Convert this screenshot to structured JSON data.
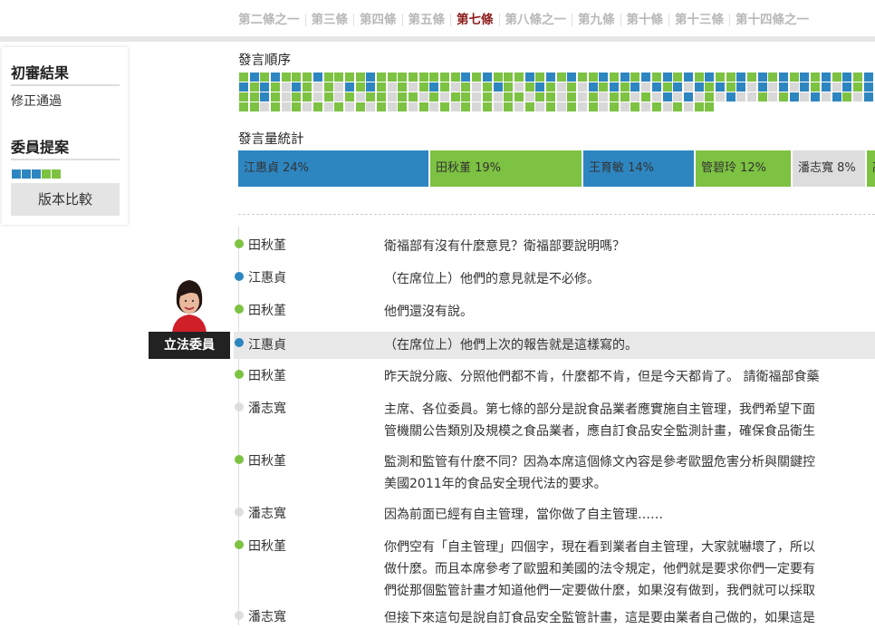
{
  "tabs": [
    "第二條之一",
    "第三條",
    "第四條",
    "第五條",
    "第七條",
    "第八條之一",
    "第九條",
    "第十條",
    "第十三條",
    "第十四條之一"
  ],
  "active_tab": 4,
  "sidebar": {
    "result_heading": "初審結果",
    "result_value": "修正通過",
    "proposal_heading": "委員提案",
    "proposal_squares": [
      "#2e86c1",
      "#2e86c1",
      "#2e86c1",
      "#7dc242",
      "#7dc242"
    ],
    "compare_button": "版本比較"
  },
  "speech_order": {
    "title": "發言順序",
    "rows": [
      [
        "g",
        "b",
        "g",
        "b",
        "g",
        "g",
        "g",
        "b",
        "g",
        "g",
        "g",
        "g",
        "b",
        "g",
        "g",
        "g",
        "g",
        "g",
        "g",
        "g",
        "g",
        "b",
        "g",
        "b",
        "g",
        "g",
        "g",
        "b",
        "g",
        "b",
        "g",
        "b",
        "g",
        "g",
        "b",
        "g",
        "b",
        "g",
        "b",
        "g",
        "b",
        "g",
        "b",
        "g",
        "b",
        "g",
        "g",
        "b",
        "g",
        "b",
        "g",
        "b",
        "g",
        "b",
        "g",
        "b",
        "g",
        "b",
        "g",
        "b"
      ],
      [
        "b",
        "g",
        "b",
        "g",
        "l",
        "b",
        "g",
        "l",
        "g",
        "l",
        "b",
        "g",
        "b",
        "g",
        "l",
        "g",
        "l",
        "g",
        "b",
        "g",
        "l",
        "g",
        "l",
        "g",
        "b",
        "g",
        "l",
        "g",
        "b",
        "g",
        "l",
        "g",
        "l",
        "b",
        "g",
        "b",
        "g",
        "b",
        "l",
        "b",
        "g",
        "b",
        "l",
        "b",
        "g",
        "b",
        "g",
        "b",
        "l",
        "b",
        "l",
        "b",
        "l",
        "b",
        "g",
        "b",
        "l",
        "b",
        "g",
        "b"
      ],
      [
        "g",
        "g",
        "b",
        "g",
        "l",
        "g",
        "g",
        "l",
        "g",
        "l",
        "g",
        "l",
        "g",
        "g",
        "l",
        "g",
        "g",
        "l",
        "g",
        "l",
        "g",
        "g",
        "l",
        "g",
        "l",
        "g",
        "g",
        "l",
        "g",
        "g",
        "l",
        "g",
        "l",
        "g",
        "l",
        "g",
        "g",
        "l",
        "g",
        "l",
        "b",
        "l",
        "b",
        "l",
        "g",
        "l",
        "b",
        "l",
        "l",
        "g",
        "l",
        "g",
        "b",
        "l",
        "b",
        "l",
        "b",
        "g",
        "l",
        "b"
      ],
      [
        "g",
        "g",
        "l",
        "g",
        "l",
        "g",
        "l",
        "g",
        "l",
        "g",
        "l",
        "g",
        "l",
        "g",
        "l",
        "g",
        "l",
        "g",
        "l",
        "g",
        "l",
        "g",
        "l",
        "g",
        "l",
        "g",
        "l",
        "g",
        "l",
        "g",
        "l",
        "g",
        "l",
        "g",
        "l",
        "g",
        "l",
        "g",
        "l",
        "g",
        "l",
        "g",
        "l",
        "g",
        "g"
      ]
    ]
  },
  "speech_stats": {
    "title": "發言量統計",
    "segments": [
      {
        "label": "江惠貞 24%",
        "color": "#2e86c1",
        "share": 24
      },
      {
        "label": "田秋堇 19%",
        "color": "#7dc242",
        "share": 19
      },
      {
        "label": "王育敏 14%",
        "color": "#2e86c1",
        "share": 14
      },
      {
        "label": "管碧玲 12%",
        "color": "#7dc242",
        "share": 12
      },
      {
        "label": "潘志寬 8%",
        "color": "#dddddd",
        "share": 8
      },
      {
        "label": "高",
        "color": "#7dc242",
        "share": 10
      }
    ]
  },
  "badge": "立法委員",
  "transcript": [
    {
      "speaker": "田秋堇",
      "color": "#7dc242",
      "lines": [
        "衛福部有沒有什麼意見？衛福部要說明嗎？"
      ]
    },
    {
      "speaker": "江惠貞",
      "color": "#2e86c1",
      "lines": [
        "（在席位上）他們的意見就是不必修。"
      ]
    },
    {
      "speaker": "田秋堇",
      "color": "#7dc242",
      "lines": [
        "他們還沒有說。"
      ]
    },
    {
      "speaker": "江惠貞",
      "color": "#2e86c1",
      "lines": [
        "（在席位上）他們上次的報告就是這樣寫的。"
      ],
      "highlight": true
    },
    {
      "speaker": "田秋堇",
      "color": "#7dc242",
      "lines": [
        "昨天說分廠、分照他們都不肯，什麼都不肯，但是今天都肯了。 請衛福部食藥"
      ]
    },
    {
      "speaker": "潘志寬",
      "color": "#dddddd",
      "lines": [
        "主席、各位委員。第七條的部分是說食品業者應實施自主管理，我們希望下面",
        "管機關公告類別及規模之食品業者，應自訂食品安全監測計畫，確保食品衛生"
      ]
    },
    {
      "speaker": "田秋堇",
      "color": "#7dc242",
      "lines": [
        "監測和監管有什麼不同？因為本席這個條文內容是參考歐盟危害分析與關鍵控",
        "美國2011年的食品安全現代法的要求。"
      ]
    },
    {
      "speaker": "潘志寬",
      "color": "#dddddd",
      "lines": [
        "因為前面已經有自主管理，當你做了自主管理……"
      ]
    },
    {
      "speaker": "田秋堇",
      "color": "#7dc242",
      "lines": [
        "你們空有「自主管理」四個字，現在看到業者自主管理，大家就嚇壞了，所以",
        "做什麼。而且本席參考了歐盟和美國的法令規定，他們就是要求你們一定要有",
        "們從那個監管計畫才知道他們一定要做什麼，如果沒有做到，我們就可以採取"
      ]
    },
    {
      "speaker": "潘志寬",
      "color": "#dddddd",
      "lines": [
        "但接下來這句是說自訂食品安全監管計畫，這是要由業者自己做的，如果這是"
      ]
    }
  ]
}
